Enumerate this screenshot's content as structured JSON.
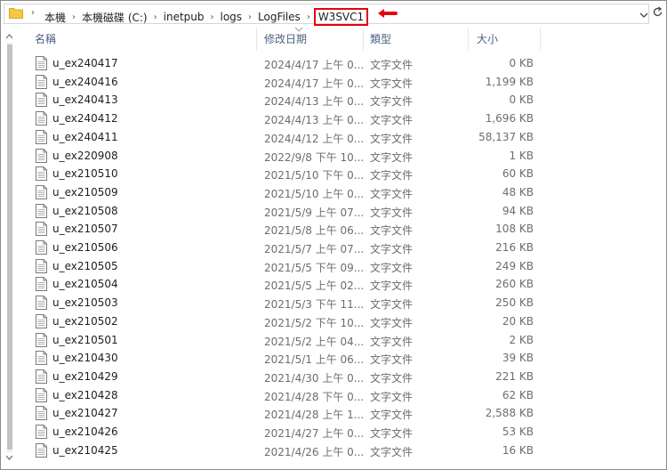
{
  "breadcrumb": {
    "items": [
      "本機",
      "本機磁碟 (C:)",
      "inetpub",
      "logs",
      "LogFiles"
    ],
    "current": "W3SVC1"
  },
  "columns": {
    "name": "名稱",
    "date": "修改日期",
    "type": "類型",
    "size": "大小"
  },
  "files": [
    {
      "name": "u_ex240417",
      "date": "2024/4/17 上午 0...",
      "type": "文字文件",
      "size": "0 KB"
    },
    {
      "name": "u_ex240416",
      "date": "2024/4/17 上午 0...",
      "type": "文字文件",
      "size": "1,199 KB"
    },
    {
      "name": "u_ex240413",
      "date": "2024/4/13 上午 0...",
      "type": "文字文件",
      "size": "0 KB"
    },
    {
      "name": "u_ex240412",
      "date": "2024/4/13 上午 0...",
      "type": "文字文件",
      "size": "1,696 KB"
    },
    {
      "name": "u_ex240411",
      "date": "2024/4/12 上午 0...",
      "type": "文字文件",
      "size": "58,137 KB"
    },
    {
      "name": "u_ex220908",
      "date": "2022/9/8 下午 10...",
      "type": "文字文件",
      "size": "1 KB"
    },
    {
      "name": "u_ex210510",
      "date": "2021/5/10 下午 0...",
      "type": "文字文件",
      "size": "60 KB"
    },
    {
      "name": "u_ex210509",
      "date": "2021/5/10 上午 0...",
      "type": "文字文件",
      "size": "48 KB"
    },
    {
      "name": "u_ex210508",
      "date": "2021/5/9 上午 07...",
      "type": "文字文件",
      "size": "94 KB"
    },
    {
      "name": "u_ex210507",
      "date": "2021/5/8 上午 06...",
      "type": "文字文件",
      "size": "108 KB"
    },
    {
      "name": "u_ex210506",
      "date": "2021/5/7 上午 07...",
      "type": "文字文件",
      "size": "216 KB"
    },
    {
      "name": "u_ex210505",
      "date": "2021/5/5 下午 09...",
      "type": "文字文件",
      "size": "249 KB"
    },
    {
      "name": "u_ex210504",
      "date": "2021/5/5 上午 02...",
      "type": "文字文件",
      "size": "260 KB"
    },
    {
      "name": "u_ex210503",
      "date": "2021/5/3 下午 11...",
      "type": "文字文件",
      "size": "250 KB"
    },
    {
      "name": "u_ex210502",
      "date": "2021/5/2 下午 10...",
      "type": "文字文件",
      "size": "20 KB"
    },
    {
      "name": "u_ex210501",
      "date": "2021/5/2 上午 04...",
      "type": "文字文件",
      "size": "2 KB"
    },
    {
      "name": "u_ex210430",
      "date": "2021/5/1 上午 06...",
      "type": "文字文件",
      "size": "39 KB"
    },
    {
      "name": "u_ex210429",
      "date": "2021/4/30 上午 0...",
      "type": "文字文件",
      "size": "221 KB"
    },
    {
      "name": "u_ex210428",
      "date": "2021/4/28 下午 0...",
      "type": "文字文件",
      "size": "62 KB"
    },
    {
      "name": "u_ex210427",
      "date": "2021/4/28 上午 1...",
      "type": "文字文件",
      "size": "2,588 KB"
    },
    {
      "name": "u_ex210426",
      "date": "2021/4/27 上午 0...",
      "type": "文字文件",
      "size": "53 KB"
    },
    {
      "name": "u_ex210425",
      "date": "2021/4/26 上午 0...",
      "type": "文字文件",
      "size": "16 KB"
    }
  ],
  "colors": {
    "highlight": "#e60012",
    "header_text": "#4d6082",
    "folder": "#f5c842"
  },
  "icons": {
    "folder": "folder-icon",
    "file": "text-file-icon",
    "refresh": "refresh-icon",
    "dropdown": "chevron-down-icon"
  }
}
